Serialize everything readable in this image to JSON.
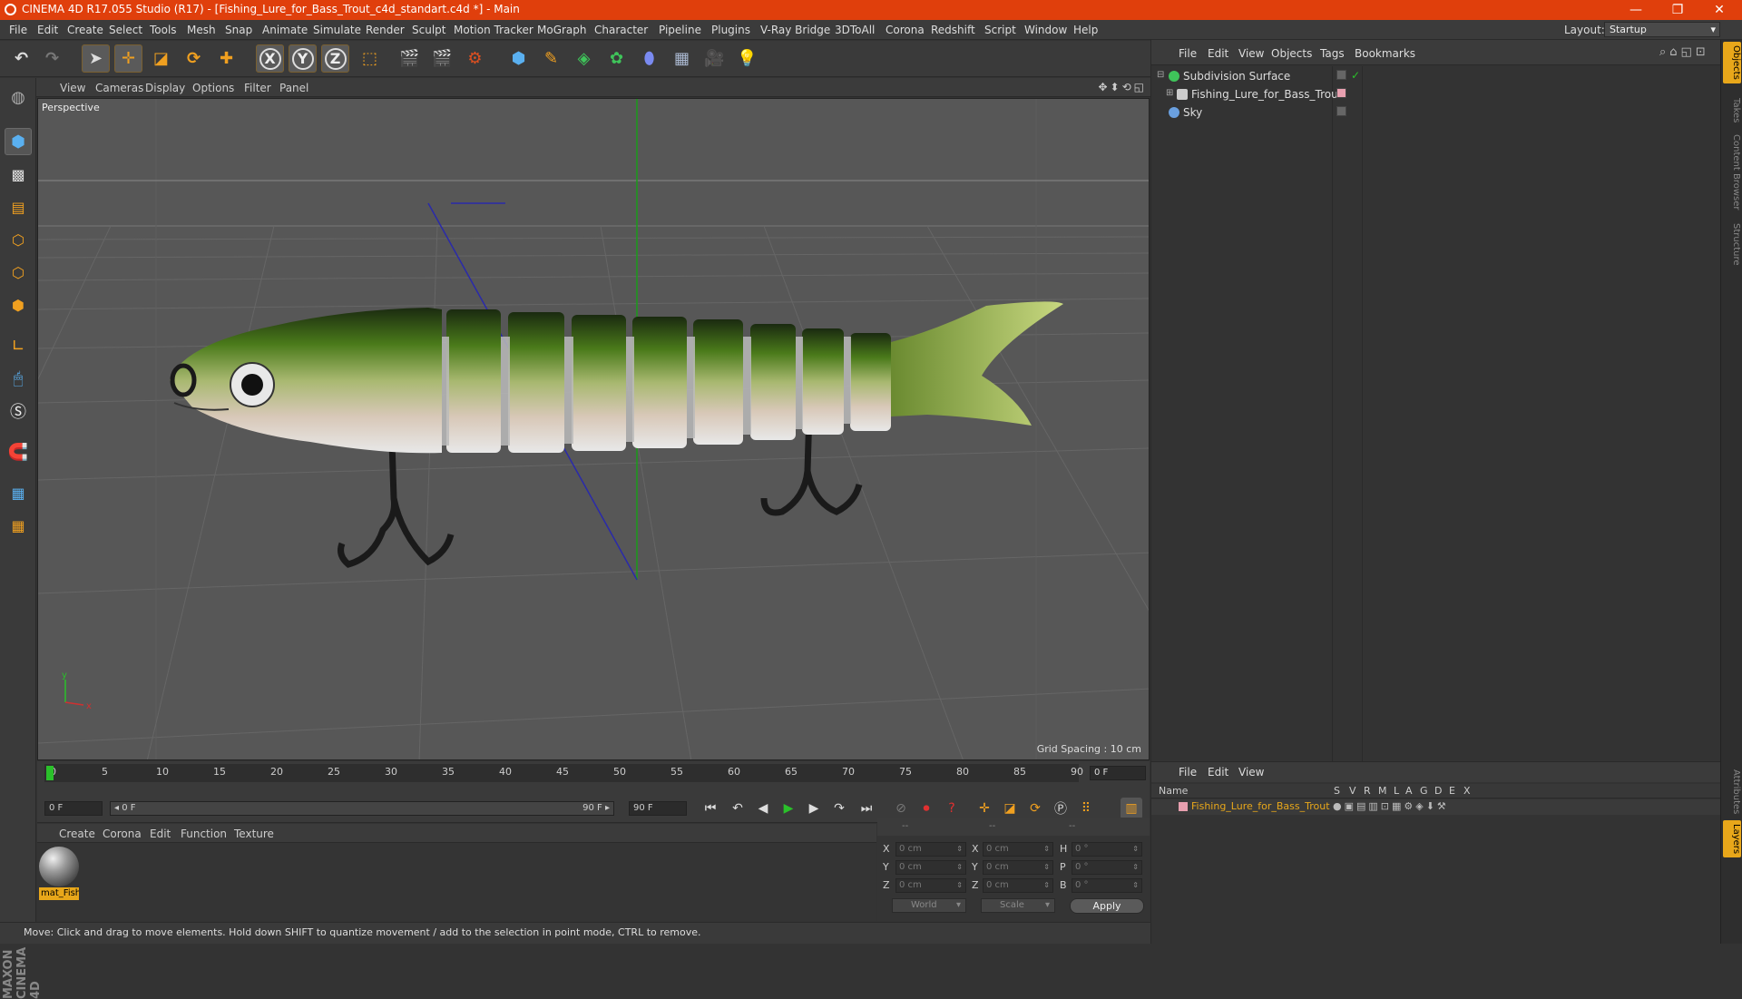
{
  "window": {
    "title": "CINEMA 4D R17.055 Studio (R17) - [Fishing_Lure_for_Bass_Trout_c4d_standart.c4d *] - Main",
    "min": "—",
    "max": "❐",
    "close": "✕"
  },
  "menu": [
    "File",
    "Edit",
    "Create",
    "Select",
    "Tools",
    "Mesh",
    "Snap",
    "Animate",
    "Simulate",
    "Render",
    "Sculpt",
    "Motion Tracker",
    "MoGraph",
    "Character",
    "Pipeline",
    "Plugins",
    "V-Ray Bridge",
    "3DToAll",
    "Corona",
    "Redshift",
    "Script",
    "Window",
    "Help"
  ],
  "layout": {
    "label": "Layout:",
    "value": "Startup",
    "arrow": "▾"
  },
  "toolbar": {
    "axis_x": "X",
    "axis_y": "Y",
    "axis_z": "Z"
  },
  "viewport": {
    "menu": [
      "View",
      "Cameras",
      "Display",
      "Options",
      "Filter",
      "Panel"
    ],
    "label": "Perspective",
    "grid_spacing": "Grid Spacing : 10 cm",
    "nav_icons": "✥⬍⟲◱",
    "axis_y": "y",
    "axis_x": "x"
  },
  "timeline": {
    "ticks": [
      "0",
      "5",
      "10",
      "15",
      "20",
      "25",
      "30",
      "35",
      "40",
      "45",
      "50",
      "55",
      "60",
      "65",
      "70",
      "75",
      "80",
      "85",
      "90"
    ],
    "current_frame": "0 F",
    "start_field": "0 F",
    "range_start": "◂ 0 F",
    "range_end": "90 F ▸",
    "end_field": "90 F"
  },
  "playback": {
    "first": "⏮",
    "prev_key": "↶",
    "prev": "◀",
    "play": "▶",
    "next": "▶",
    "next_key": "↷",
    "last": "⏭"
  },
  "material_manager": {
    "menu": [
      "Create",
      "Corona",
      "Edit",
      "Function",
      "Texture"
    ],
    "material_name": "mat_Fishi"
  },
  "coordinates": {
    "headers": [
      "--",
      "--",
      "--"
    ],
    "rows": [
      {
        "l1": "X",
        "v1": "0 cm",
        "l2": "X",
        "v2": "0 cm",
        "l3": "H",
        "v3": "0 °"
      },
      {
        "l1": "Y",
        "v1": "0 cm",
        "l2": "Y",
        "v2": "0 cm",
        "l3": "P",
        "v3": "0 °"
      },
      {
        "l1": "Z",
        "v1": "0 cm",
        "l2": "Z",
        "v2": "0 cm",
        "l3": "B",
        "v3": "0 °"
      }
    ],
    "mode": "World",
    "size_mode": "Scale",
    "apply": "Apply",
    "arrow": "▾",
    "spin": "⇕"
  },
  "status": "Move: Click and drag to move elements. Hold down SHIFT to quantize movement / add to the selection in point mode, CTRL to remove.",
  "object_manager": {
    "menu": [
      "File",
      "Edit",
      "View",
      "Objects",
      "Tags",
      "Bookmarks"
    ],
    "objects": [
      {
        "name": "Subdivision Surface",
        "icon_color": "#3fc45a"
      },
      {
        "name": "Fishing_Lure_for_Bass_Trout",
        "icon_color": "#cccccc"
      },
      {
        "name": "Sky",
        "icon_color": "#6aa0e0"
      }
    ],
    "check": "✓"
  },
  "layer_manager": {
    "menu": [
      "File",
      "Edit",
      "View"
    ],
    "columns": [
      "Name",
      "S",
      "V",
      "R",
      "M",
      "L",
      "A",
      "G",
      "D",
      "E",
      "X"
    ],
    "layer_name": "Fishing_Lure_for_Bass_Trout",
    "layer_color": "#e8a0b0"
  },
  "side_tabs": [
    "Objects",
    "Takes",
    "Content Browser",
    "Structure"
  ],
  "side_tabs_bottom": [
    "Attributes",
    "Layers"
  ],
  "maxon": "MAXON CINEMA 4D",
  "colors": {
    "titlebar": "#e03f0c",
    "accent": "#e8a71a",
    "viewport": "#575757"
  }
}
